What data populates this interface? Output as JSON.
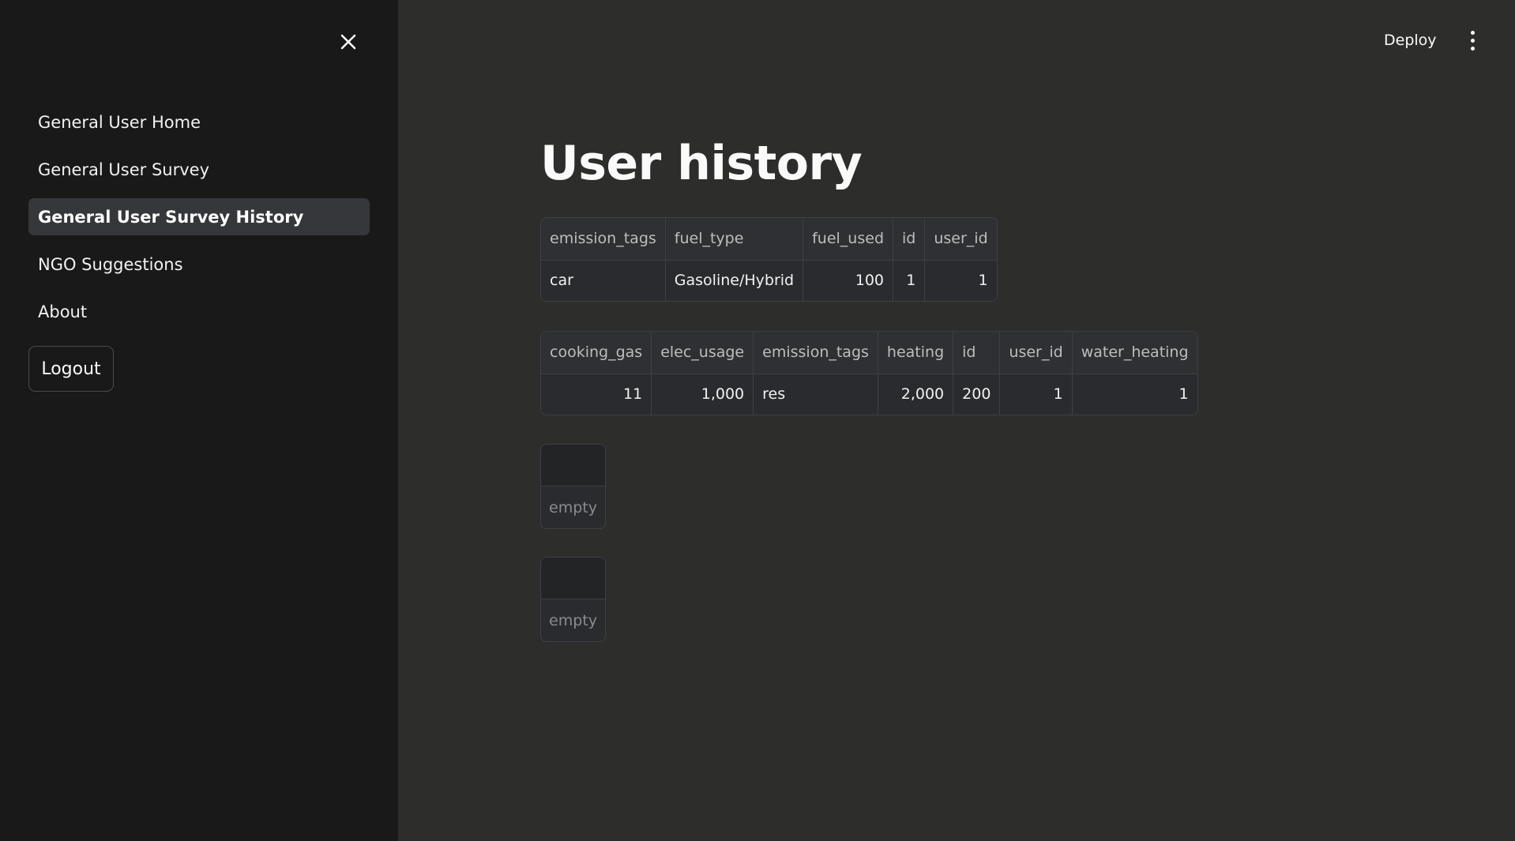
{
  "sidebar": {
    "close_icon": "close-icon",
    "items": [
      {
        "label": "General User Home"
      },
      {
        "label": "General User Survey"
      },
      {
        "label": "General User Survey History",
        "active": true
      },
      {
        "label": "NGO Suggestions"
      },
      {
        "label": "About"
      }
    ],
    "logout_label": "Logout"
  },
  "header": {
    "deploy_label": "Deploy",
    "menu_icon": "kebab-menu-icon"
  },
  "main": {
    "title": "User history",
    "table1": {
      "columns": [
        "emission_tags",
        "fuel_type",
        "fuel_used",
        "id",
        "user_id"
      ],
      "rows": [
        [
          "car",
          "Gasoline/Hybrid",
          "100",
          "1",
          "1"
        ]
      ]
    },
    "table2": {
      "columns": [
        "cooking_gas",
        "elec_usage",
        "emission_tags",
        "heating",
        "id",
        "user_id",
        "water_heating"
      ],
      "rows": [
        [
          "11",
          "1,000",
          "res",
          "2,000",
          "200",
          "1",
          "1"
        ]
      ]
    },
    "empty1_label": "empty",
    "empty2_label": "empty"
  },
  "colors": {
    "sidebar_bg": "#191919",
    "main_bg": "#2d2e2b",
    "active_item_bg": "#36373a"
  }
}
